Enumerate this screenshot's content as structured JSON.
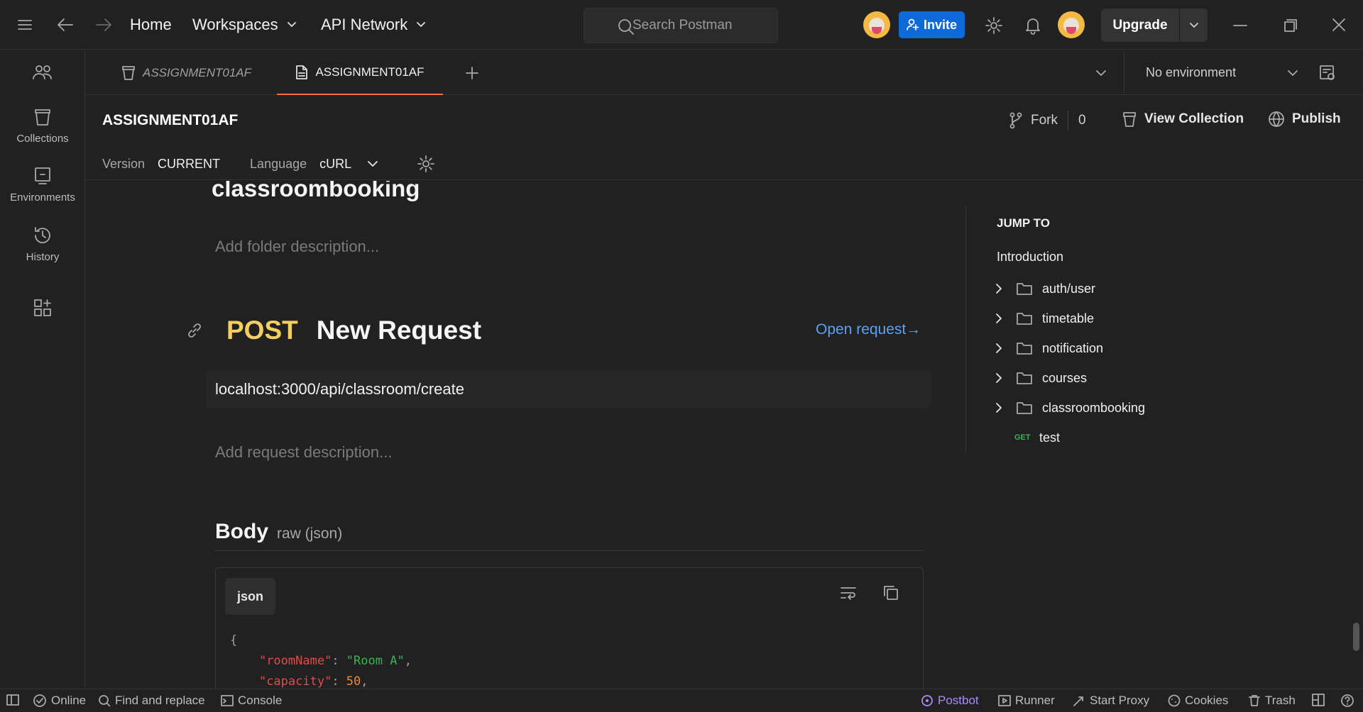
{
  "topbar": {
    "home": "Home",
    "workspaces": "Workspaces",
    "api_network": "API Network",
    "search_placeholder": "Search Postman",
    "invite": "Invite",
    "upgrade": "Upgrade"
  },
  "sidebar": {
    "items": [
      {
        "label": ""
      },
      {
        "label": "Collections"
      },
      {
        "label": "Environments"
      },
      {
        "label": "History"
      }
    ]
  },
  "tabs": {
    "items": [
      {
        "label": "ASSIGNMENT01AF",
        "active": false
      },
      {
        "label": "ASSIGNMENT01AF",
        "active": true
      }
    ],
    "environment": "No environment"
  },
  "doc": {
    "title": "ASSIGNMENT01AF",
    "version_label": "Version",
    "version_value": "CURRENT",
    "language_label": "Language",
    "language_value": "cURL",
    "fork_label": "Fork",
    "fork_count": "0",
    "view_collection": "View Collection",
    "publish": "Publish"
  },
  "content": {
    "folder_title": "classroombooking",
    "folder_desc_placeholder": "Add folder description...",
    "request_method": "POST",
    "request_name": "New Request",
    "open_request": "Open request→",
    "request_url": "localhost:3000/api/classroom/create",
    "request_desc_placeholder": "Add request description...",
    "body_heading": "Body",
    "body_type": "raw (json)",
    "code_lang": "json",
    "code_lines": {
      "l1_brace": "{",
      "l2_key": "\"roomName\"",
      "l2_val": "\"Room A\"",
      "l3_key": "\"capacity\"",
      "l3_val": "50"
    }
  },
  "jump_to": {
    "heading": "JUMP TO",
    "intro": "Introduction",
    "folders": [
      "auth/user",
      "timetable",
      "notification",
      "courses",
      "classroombooking"
    ],
    "request_method": "GET",
    "request_name": "test"
  },
  "statusbar": {
    "online": "Online",
    "find_replace": "Find and replace",
    "console": "Console",
    "postbot": "Postbot",
    "runner": "Runner",
    "start_proxy": "Start Proxy",
    "cookies": "Cookies",
    "trash": "Trash"
  },
  "colors": {
    "background": "#212121",
    "accent_orange": "#ff6c37",
    "post_method": "#f4ce5e",
    "get_method": "#3fb154",
    "link_blue": "#5aa2f5",
    "invite_blue": "#0d6ad8"
  },
  "icons": [
    "menu-icon",
    "back-arrow-icon",
    "forward-arrow-icon",
    "search-icon",
    "settings-gear-icon",
    "bell-icon",
    "fork-icon",
    "publish-globe-icon",
    "link-icon",
    "wrap-lines-icon",
    "copy-icon",
    "folder-icon",
    "chevron-right-icon"
  ]
}
